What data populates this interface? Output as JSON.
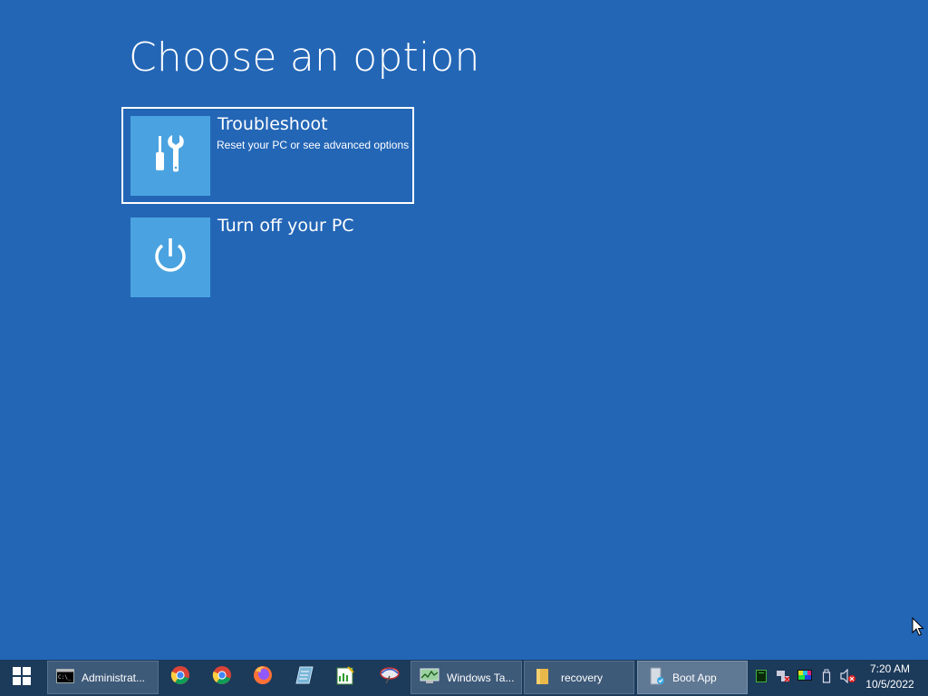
{
  "screen": {
    "title": "Choose an option"
  },
  "options": [
    {
      "title": "Troubleshoot",
      "description": "Reset your PC or see advanced options",
      "icon": "tools-icon",
      "selected": true
    },
    {
      "title": "Turn off your PC",
      "description": "",
      "icon": "power-icon",
      "selected": false
    }
  ],
  "colors": {
    "background": "#2366b6",
    "tile": "#4aa3e0",
    "taskbar": "#1c3a5a"
  },
  "taskbar": {
    "start_icon": "windows-logo-icon",
    "windows": [
      {
        "label": "Administrat...",
        "icon": "command-prompt-icon",
        "active": false
      },
      {
        "label": "Windows Ta...",
        "icon": "task-manager-icon",
        "active": false
      },
      {
        "label": "recovery",
        "icon": "folder-icon",
        "active": false
      },
      {
        "label": "Boot App",
        "icon": "boot-app-icon",
        "active": true
      }
    ],
    "pinned": [
      "chrome-icon",
      "chrome-icon",
      "firefox-icon",
      "notepad-icon",
      "spreadsheet-icon",
      "network-tool-icon"
    ],
    "tray": [
      "terminal-tray-icon",
      "network-disconnected-icon",
      "display-icon",
      "usb-icon",
      "volume-muted-icon"
    ],
    "clock": {
      "time": "7:20 AM",
      "date": "10/5/2022"
    }
  }
}
